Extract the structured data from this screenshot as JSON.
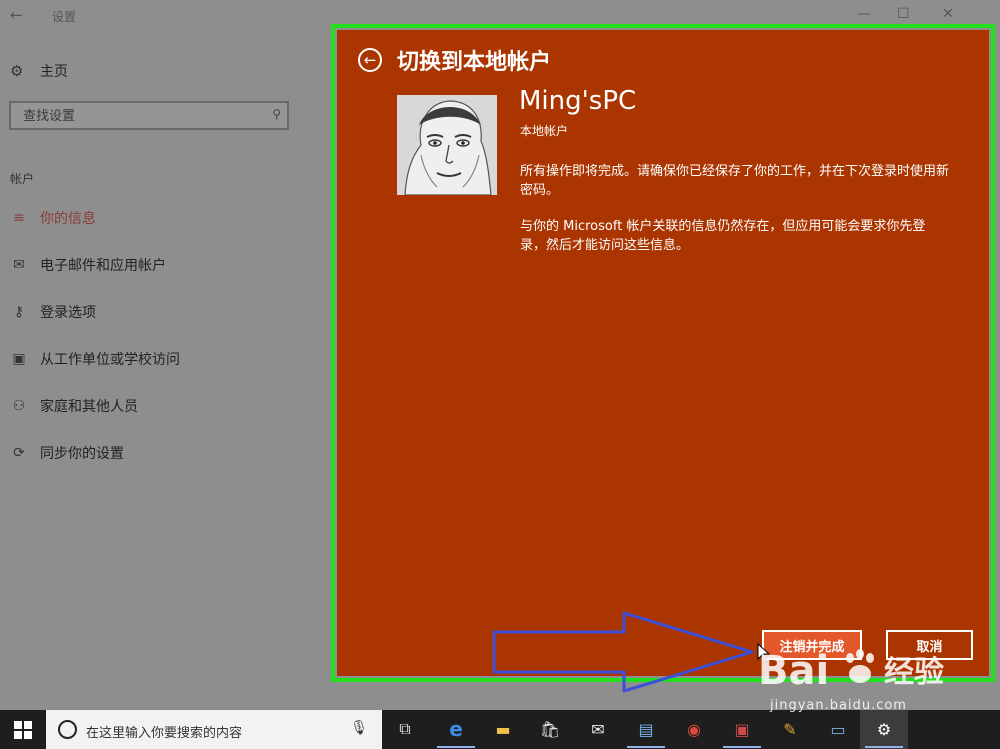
{
  "window": {
    "title": "设置",
    "back_glyph": "←",
    "controls": {
      "minimize": "—",
      "maximize": "☐",
      "close": "✕"
    }
  },
  "sidebar": {
    "home_label": "主页",
    "search_placeholder": "查找设置",
    "section_label": "帐户",
    "items": [
      {
        "label": "你的信息",
        "icon": "person-card-icon",
        "glyph": "≡",
        "active": true
      },
      {
        "label": "电子邮件和应用帐户",
        "icon": "envelope-icon",
        "glyph": "✉"
      },
      {
        "label": "登录选项",
        "icon": "key-icon",
        "glyph": "⚷"
      },
      {
        "label": "从工作单位或学校访问",
        "icon": "briefcase-icon",
        "glyph": "▣"
      },
      {
        "label": "家庭和其他人员",
        "icon": "person-add-icon",
        "glyph": "⚇"
      },
      {
        "label": "同步你的设置",
        "icon": "sync-icon",
        "glyph": "⟳"
      }
    ]
  },
  "dialog": {
    "title": "切换到本地帐户",
    "account_name": "Ming'sPC",
    "account_type": "本地帐户",
    "message1": "所有操作即将完成。请确保你已经保存了你的工作，并在下次登录时使用新密码。",
    "message2": "与你的 Microsoft 帐户关联的信息仍然存在，但应用可能会要求你先登录，然后才能访问这些信息。",
    "primary_button": "注销并完成",
    "cancel_button": "取消"
  },
  "taskbar": {
    "search_text": "在这里输入你要搜索的内容",
    "icons": [
      "task-view-icon",
      "edge-icon",
      "file-explorer-icon",
      "store-icon",
      "mail-icon",
      "calendar-app-icon",
      "network-app-icon",
      "remote-app-icon",
      "paint-icon",
      "computer-app-icon",
      "settings-icon"
    ]
  },
  "watermark": {
    "text": "Bai 经验",
    "url": "jingyan.baidu.com"
  },
  "colors": {
    "dialog_bg": "#ab3500",
    "primary_button_bg": "#e2582a",
    "annotation_outline": "#22e01c",
    "annotation_arrow": "#3b4fd8"
  }
}
